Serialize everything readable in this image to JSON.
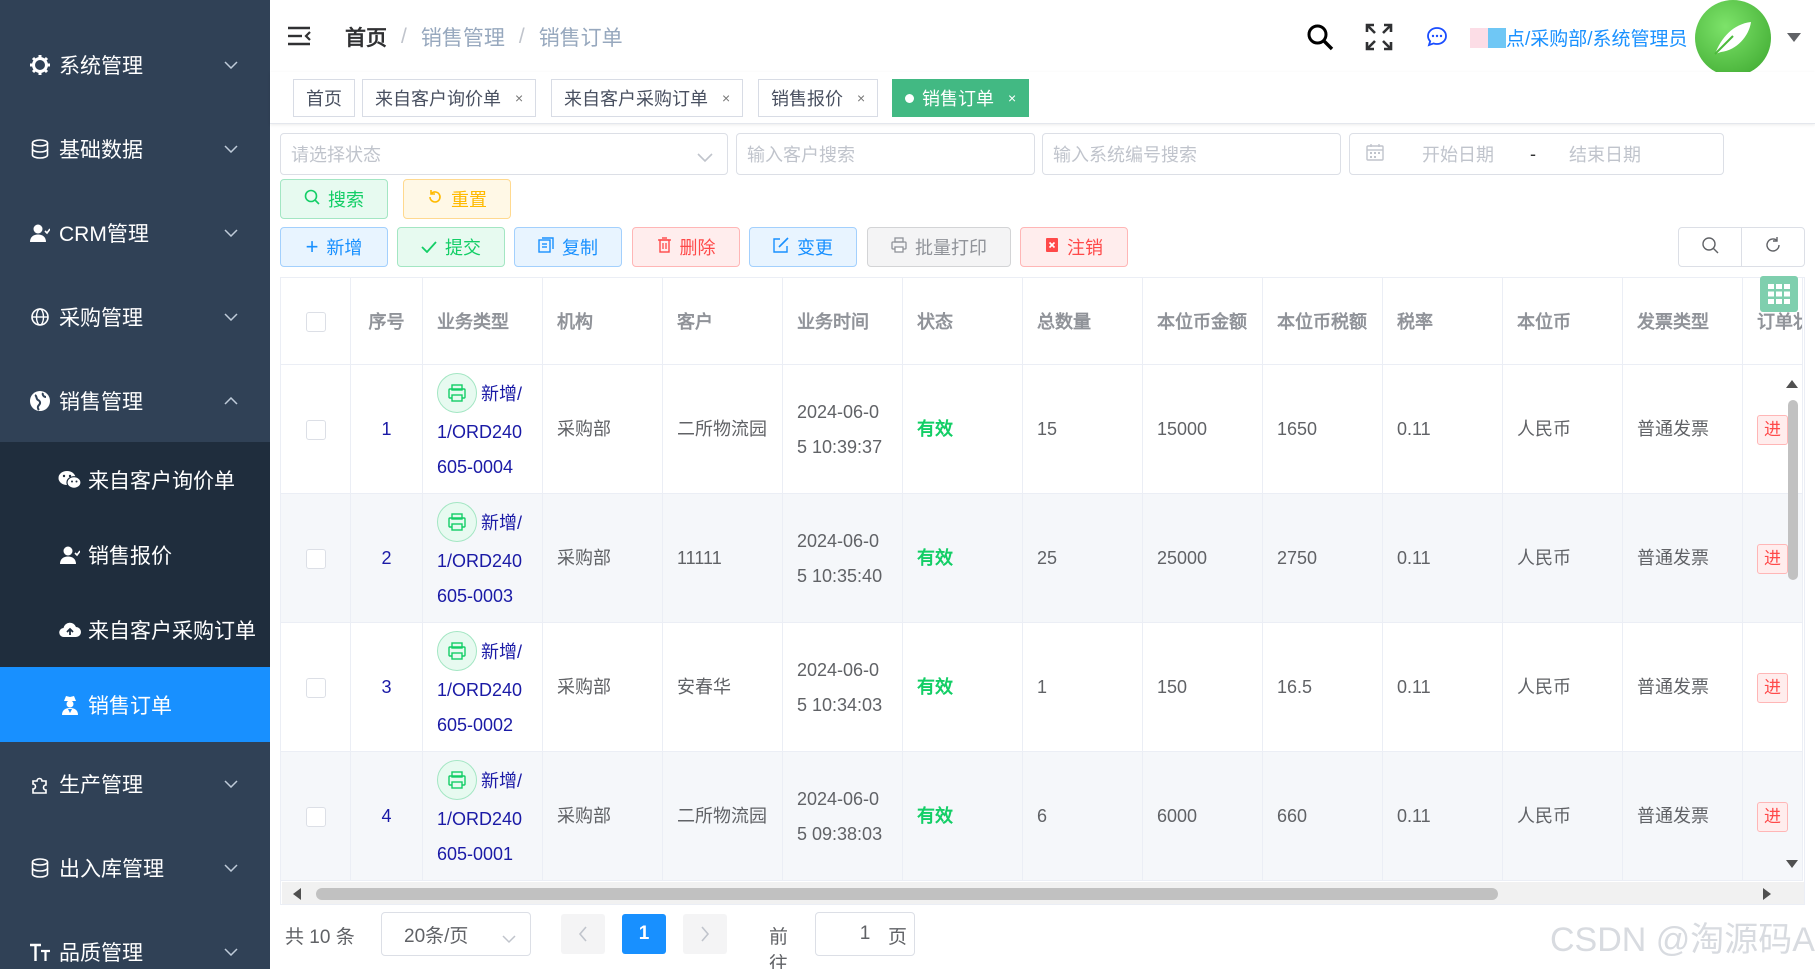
{
  "sidebar": {
    "menus": [
      {
        "label": "系统管理",
        "icon": "gear-icon"
      },
      {
        "label": "基础数据",
        "icon": "database-icon"
      },
      {
        "label": "CRM管理",
        "icon": "user-icon"
      },
      {
        "label": "采购管理",
        "icon": "globe-icon"
      },
      {
        "label": "销售管理",
        "icon": "globe-icon",
        "expanded": true
      },
      {
        "label": "生产管理",
        "icon": "puzzle-icon"
      },
      {
        "label": "出入库管理",
        "icon": "database-icon"
      },
      {
        "label": "品质管理",
        "icon": "text-size-icon"
      }
    ],
    "sub_items": [
      {
        "label": "来自客户询价单",
        "icon": "wechat-icon"
      },
      {
        "label": "销售报价",
        "icon": "user-icon"
      },
      {
        "label": "来自客户采购订单",
        "icon": "cloud-upload-icon"
      },
      {
        "label": "销售订单",
        "icon": "user-secret-icon",
        "active": true
      }
    ]
  },
  "header": {
    "breadcrumb": [
      "首页",
      "销售管理",
      "销售订单"
    ],
    "user": "点/采购部/系统管理员"
  },
  "tags": [
    {
      "label": "首页"
    },
    {
      "label": "来自客户询价单",
      "close": "×"
    },
    {
      "label": "来自客户采购订单",
      "close": "×"
    },
    {
      "label": "销售报价",
      "close": "×"
    },
    {
      "label": "销售订单",
      "close": "×",
      "active": true
    }
  ],
  "search": {
    "status_placeholder": "请选择状态",
    "customer_placeholder": "输入客户搜索",
    "code_placeholder": "输入系统编号搜索",
    "start_date": "开始日期",
    "date_sep": "-",
    "end_date": "结束日期",
    "search_btn": "搜索",
    "reset_btn": "重置"
  },
  "toolbar": {
    "add": "新增",
    "submit": "提交",
    "copy": "复制",
    "delete": "删除",
    "change": "变更",
    "batch_print": "批量打印",
    "cancel": "注销"
  },
  "table": {
    "columns": [
      "序号",
      "业务类型",
      "机构",
      "客户",
      "业务时间",
      "状态",
      "总数量",
      "本位币金额",
      "本位币税额",
      "税率",
      "本位币",
      "发票类型",
      "订单状"
    ],
    "rows": [
      {
        "seq": "1",
        "biz_type": "新增/",
        "biz_no": "1/ORD240605-0004",
        "org": "采购部",
        "customer": "二所物流园",
        "time": "2024-06-05 10:39:37",
        "status": "有效",
        "qty": "15",
        "amount": "15000",
        "tax": "1650",
        "rate": "0.11",
        "currency": "人民币",
        "invoice": "普通发票",
        "order_status": "进"
      },
      {
        "seq": "2",
        "biz_type": "新增/",
        "biz_no": "1/ORD240605-0003",
        "org": "采购部",
        "customer": "11111",
        "time": "2024-06-05 10:35:40",
        "status": "有效",
        "qty": "25",
        "amount": "25000",
        "tax": "2750",
        "rate": "0.11",
        "currency": "人民币",
        "invoice": "普通发票",
        "order_status": "进"
      },
      {
        "seq": "3",
        "biz_type": "新增/",
        "biz_no": "1/ORD240605-0002",
        "org": "采购部",
        "customer": "安春华",
        "time": "2024-06-05 10:34:03",
        "status": "有效",
        "qty": "1",
        "amount": "150",
        "tax": "16.5",
        "rate": "0.11",
        "currency": "人民币",
        "invoice": "普通发票",
        "order_status": "进"
      },
      {
        "seq": "4",
        "biz_type": "新增/",
        "biz_no": "1/ORD240605-0001",
        "org": "采购部",
        "customer": "二所物流园",
        "time": "2024-06-05 09:38:03",
        "status": "有效",
        "qty": "6",
        "amount": "6000",
        "tax": "660",
        "rate": "0.11",
        "currency": "人民币",
        "invoice": "普通发票",
        "order_status": "进"
      }
    ]
  },
  "pagination": {
    "total": "共 10 条",
    "page_size": "20条/页",
    "current": "1",
    "goto_label": "前往",
    "goto_value": "1",
    "page_suffix": "页"
  },
  "watermark": "CSDN @淘源码A",
  "colors": {
    "sidebar_bg": "#304156",
    "active": "#1890ff",
    "tag_active": "#42b983",
    "valid": "#13ce66"
  }
}
